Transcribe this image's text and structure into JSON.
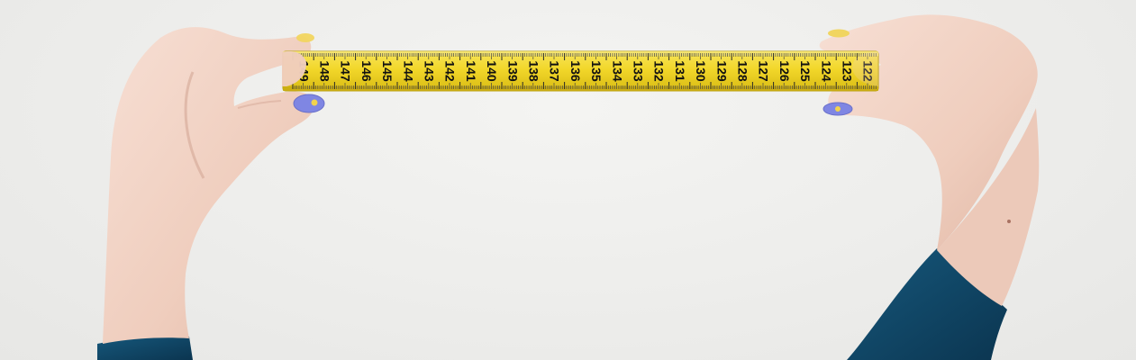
{
  "scene": {
    "subject": "hands-holding-measuring-tape",
    "colors": {
      "background": "#efefed",
      "tape": "#f1d62b",
      "tape_edge": "#c9ad14",
      "skin": "#f0d2c4",
      "skin_shadow": "#ddb4a4",
      "nail_polish": "#7f86e3",
      "sleeve": "#0f4461"
    }
  },
  "tape": {
    "numbers": [
      "149",
      "148",
      "147",
      "146",
      "145",
      "144",
      "143",
      "142",
      "141",
      "140",
      "139",
      "138",
      "137",
      "136",
      "135",
      "134",
      "133",
      "132",
      "131",
      "130",
      "129",
      "128",
      "127",
      "126",
      "125",
      "124",
      "123",
      "122"
    ]
  }
}
